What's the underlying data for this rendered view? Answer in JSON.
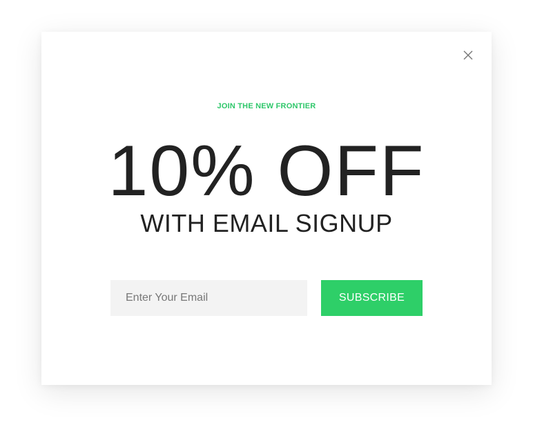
{
  "modal": {
    "eyebrow": "JOIN THE NEW FRONTIER",
    "headline": "10% OFF",
    "subhead": "WITH EMAIL SIGNUP",
    "email_placeholder": "Enter Your Email",
    "email_value": "",
    "subscribe_label": "SUBSCRIBE",
    "close_icon": "close-icon"
  },
  "colors": {
    "accent": "#2ecf68",
    "heading": "#222222",
    "input_bg": "#f3f3f3"
  }
}
